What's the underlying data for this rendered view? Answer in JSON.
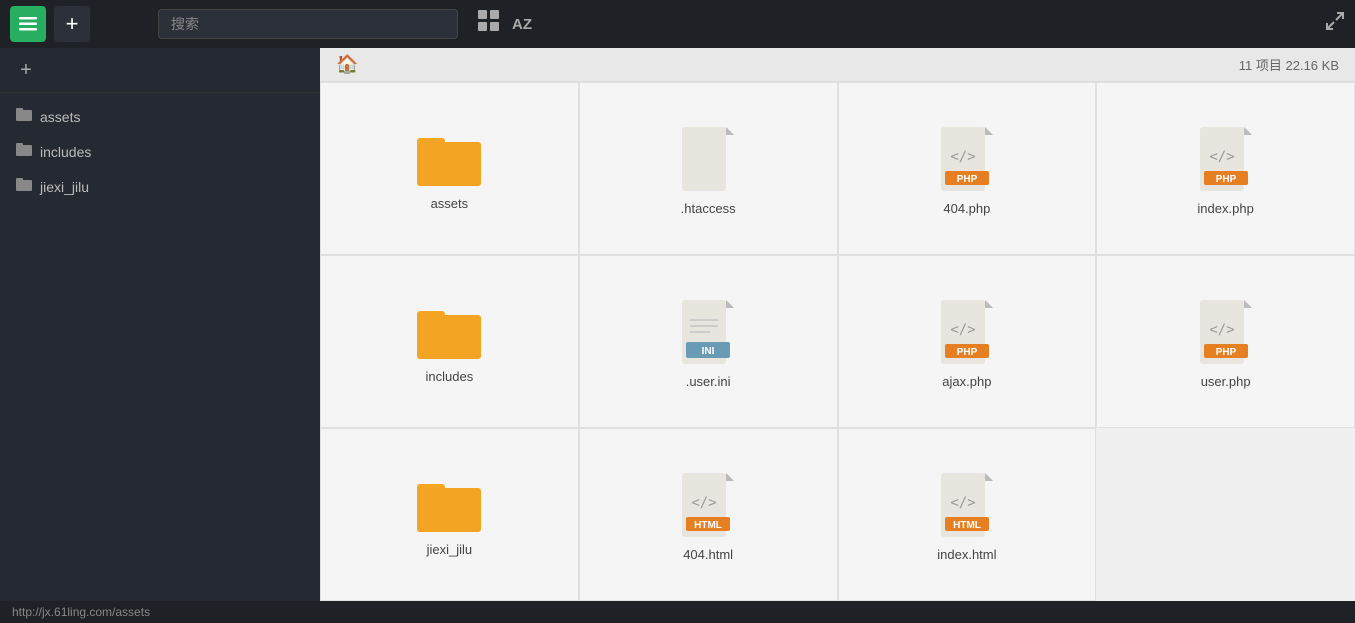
{
  "topbar": {
    "menu_icon": "☰",
    "add_icon": "+",
    "search_placeholder": "搜索",
    "grid_icon": "⊞",
    "sort_icon": "AZ",
    "expand_icon": "⤢"
  },
  "sidebar": {
    "add_label": "+",
    "items": [
      {
        "id": "assets",
        "label": "assets",
        "icon": "folder"
      },
      {
        "id": "includes",
        "label": "includes",
        "icon": "folder"
      },
      {
        "id": "jiexi_jilu",
        "label": "jiexi_jilu",
        "icon": "folder"
      }
    ]
  },
  "file_panel": {
    "breadcrumb_home": "🏠",
    "count_label": "11 项目  22.16 KB",
    "files": [
      {
        "id": "assets-folder",
        "name": "assets",
        "type": "folder"
      },
      {
        "id": "htaccess",
        "name": ".htaccess",
        "type": "blank"
      },
      {
        "id": "404php",
        "name": "404.php",
        "type": "php"
      },
      {
        "id": "indexphp",
        "name": "index.php",
        "type": "php"
      },
      {
        "id": "includes-folder",
        "name": "includes",
        "type": "folder"
      },
      {
        "id": "userini",
        "name": ".user.ini",
        "type": "ini"
      },
      {
        "id": "ajaxphp",
        "name": "ajax.php",
        "type": "php"
      },
      {
        "id": "userphp",
        "name": "user.php",
        "type": "php"
      },
      {
        "id": "jiexi-folder",
        "name": "jiexi_jilu",
        "type": "folder"
      },
      {
        "id": "404html",
        "name": "404.html",
        "type": "html"
      },
      {
        "id": "indexhtml",
        "name": "index.html",
        "type": "html"
      }
    ]
  },
  "statusbar": {
    "url": "http://jx.61ling.com/assets"
  }
}
